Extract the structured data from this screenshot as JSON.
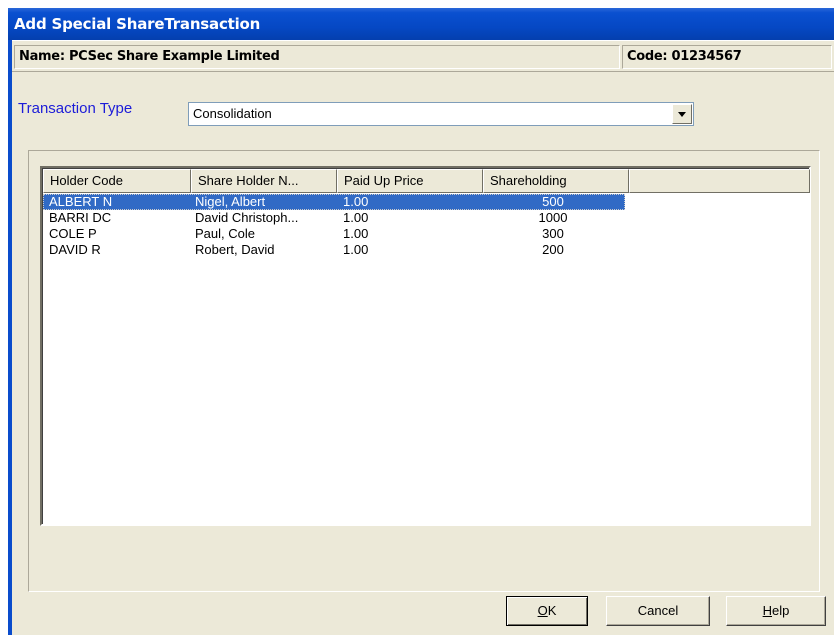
{
  "window": {
    "title": "Add Special ShareTransaction"
  },
  "header": {
    "name": "Name: PCSec Share Example Limited",
    "code": "Code: 01234567"
  },
  "transaction_type": {
    "label": "Transaction Type",
    "value": "Consolidation"
  },
  "table": {
    "columns": [
      "Holder Code",
      "Share Holder N...",
      "Paid Up Price",
      "Shareholding"
    ],
    "rows": [
      [
        "ALBERT N",
        "Nigel, Albert",
        "1.00",
        "500"
      ],
      [
        "BARRI DC",
        "David Christoph...",
        "1.00",
        "1000"
      ],
      [
        "COLE P",
        "Paul, Cole",
        "1.00",
        "300"
      ],
      [
        "DAVID R",
        "Robert, David",
        "1.00",
        "200"
      ]
    ],
    "selected_row": 0
  },
  "buttons": {
    "ok": {
      "mnemonic": "O",
      "rest": "K"
    },
    "cancel": "Cancel",
    "help": {
      "mnemonic": "H",
      "rest": "elp"
    }
  },
  "icons": [
    "dropdown-arrow-icon"
  ],
  "colors": {
    "title_bar": "#0548c4",
    "selection": "#316ac5",
    "label_blue": "#1c1cd8",
    "dialog_bg": "#ece9d8"
  }
}
